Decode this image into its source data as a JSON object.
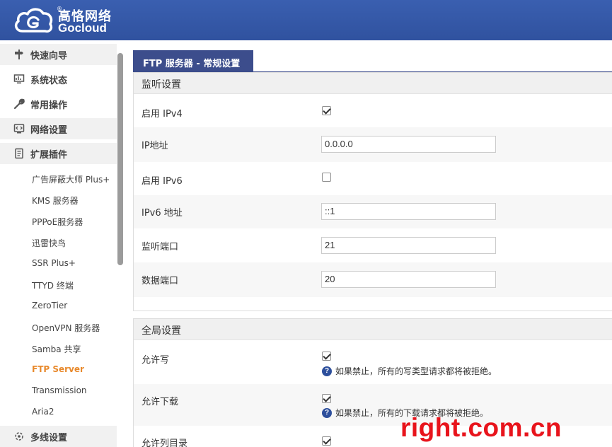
{
  "brand": {
    "cn": "高恪网络",
    "en": "Gocloud",
    "reg": "®",
    "color": "#3a5fb0"
  },
  "sidebar": {
    "items": [
      {
        "label": "快速向导",
        "icon": "signpost-icon"
      },
      {
        "label": "系统状态",
        "icon": "monitor-icon"
      },
      {
        "label": "常用操作",
        "icon": "wrench-icon"
      },
      {
        "label": "网络设置",
        "icon": "network-icon"
      },
      {
        "label": "扩展插件",
        "icon": "plugin-icon"
      }
    ],
    "sub_items": [
      "广告屏蔽大师 Plus+",
      "KMS 服务器",
      "PPPoE服务器",
      "迅雷快鸟",
      "SSR Plus+",
      "TTYD 终端",
      "ZeroTier",
      "OpenVPN 服务器",
      "Samba 共享",
      "FTP Server",
      "Transmission",
      "Aria2"
    ],
    "active_sub": "FTP Server",
    "active_color": "#e8892c",
    "bottom_item": {
      "label": "多线设置",
      "icon": "multiline-icon"
    }
  },
  "tab": {
    "label": "FTP 服务器 - 常规设置"
  },
  "listen": {
    "title": "监听设置",
    "ipv4_label": "启用 IPv4",
    "ipv4_checked": true,
    "ip_label": "IP地址",
    "ip_value": "0.0.0.0",
    "ipv6_label": "启用 IPv6",
    "ipv6_checked": false,
    "ipv6_addr_label": "IPv6 地址",
    "ipv6_addr_value": "::1",
    "port_label": "监听端口",
    "port_value": "21",
    "data_port_label": "数据端口",
    "data_port_value": "20"
  },
  "global": {
    "title": "全局设置",
    "write_label": "允许写",
    "write_checked": true,
    "write_hint": "如果禁止，所有的写类型请求都将被拒绝。",
    "download_label": "允许下载",
    "download_checked": true,
    "download_hint": "如果禁止，所有的下载请求都将被拒绝。",
    "list_label": "允许列目录",
    "list_checked": true
  },
  "watermark": "right.com.cn"
}
